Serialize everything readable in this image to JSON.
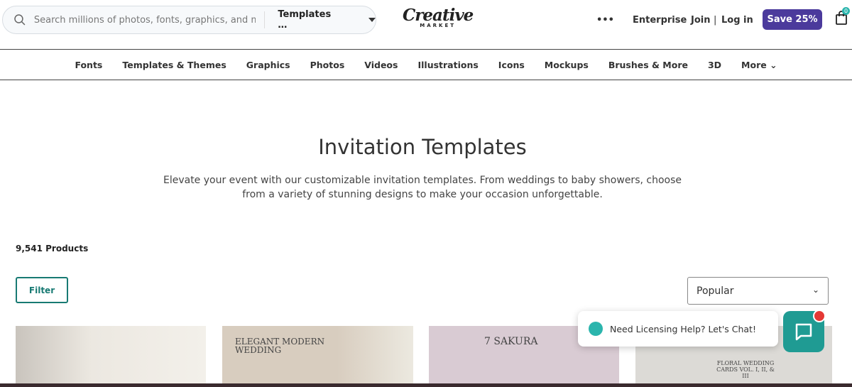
{
  "header": {
    "search_placeholder": "Search millions of photos, fonts, graphics, and mo…",
    "search_category": "Templates …",
    "logo_main": "Creative",
    "logo_sub": "MARKET",
    "more_dots": "•••",
    "enterprise": "Enterprise",
    "join": "Join",
    "divider": "|",
    "login": "Log in",
    "save_button": "Save 25%",
    "cart_count": "0"
  },
  "nav": {
    "items": [
      "Fonts",
      "Templates & Themes",
      "Graphics",
      "Photos",
      "Videos",
      "Illustrations",
      "Icons",
      "Mockups",
      "Brushes & More",
      "3D",
      "More ⌄"
    ]
  },
  "main": {
    "title": "Invitation Templates",
    "description": "Elevate your event with our customizable invitation templates. From weddings to baby showers, choose from a variety of stunning designs to make your occasion unforgettable.",
    "product_count": "9,541 Products",
    "filter_label": "Filter",
    "sort_value": "Popular"
  },
  "cards": [
    {
      "text": ""
    },
    {
      "text": "ELEGANT MODERN WEDDING"
    },
    {
      "text": "7 SAKURA"
    },
    {
      "text": "FLORAL WEDDING CARDS VOL. I, II, & III"
    }
  ],
  "chat": {
    "label": "Need Licensing Help? Let's Chat!"
  },
  "colors": {
    "accent": "#4b3a9c",
    "teal": "#187a73"
  }
}
